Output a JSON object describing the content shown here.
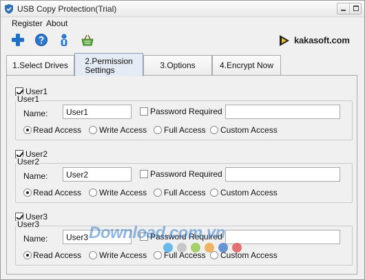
{
  "window": {
    "title": "USB Copy Protection(Trial)"
  },
  "menu": {
    "items": [
      "Register",
      "About"
    ]
  },
  "toolbar": {
    "icons": [
      "add-icon",
      "help-icon",
      "user-icon",
      "basket-icon"
    ]
  },
  "logo": {
    "text": "kakasoft.com"
  },
  "tabs": [
    {
      "label": "1.Select Drives",
      "active": false
    },
    {
      "label": "2.Permission\nSettings",
      "active": true
    },
    {
      "label": "3.Options",
      "active": false
    },
    {
      "label": "4.Encrypt Now",
      "active": false
    }
  ],
  "users": [
    {
      "checkbox_label": "User1",
      "checked": true,
      "group_title": "User1",
      "name_label": "Name:",
      "name_value": "User1",
      "password_label": "Password Required",
      "password_checked": false,
      "password_value": "",
      "access_options": [
        "Read Access",
        "Write Access",
        "Full Access",
        "Custom Access"
      ],
      "selected_access": "Read Access"
    },
    {
      "checkbox_label": "User2",
      "checked": true,
      "group_title": "User2",
      "name_label": "Name:",
      "name_value": "User2",
      "password_label": "Password Required",
      "password_checked": false,
      "password_value": "",
      "access_options": [
        "Read Access",
        "Write Access",
        "Full Access",
        "Custom Access"
      ],
      "selected_access": "Read Access"
    },
    {
      "checkbox_label": "User3",
      "checked": true,
      "group_title": "User3",
      "name_label": "Name:",
      "name_value": "User3",
      "password_label": "Password Required",
      "password_checked": false,
      "password_value": "",
      "access_options": [
        "Read Access",
        "Write Access",
        "Full Access",
        "Custom Access"
      ],
      "selected_access": "Read Access"
    }
  ],
  "watermark": {
    "text": "Download.com.vn",
    "dot_colors": [
      "#3aa8e6",
      "#b9b9b9",
      "#8cc43c",
      "#f0a030",
      "#3b74c8",
      "#e0484a"
    ]
  }
}
